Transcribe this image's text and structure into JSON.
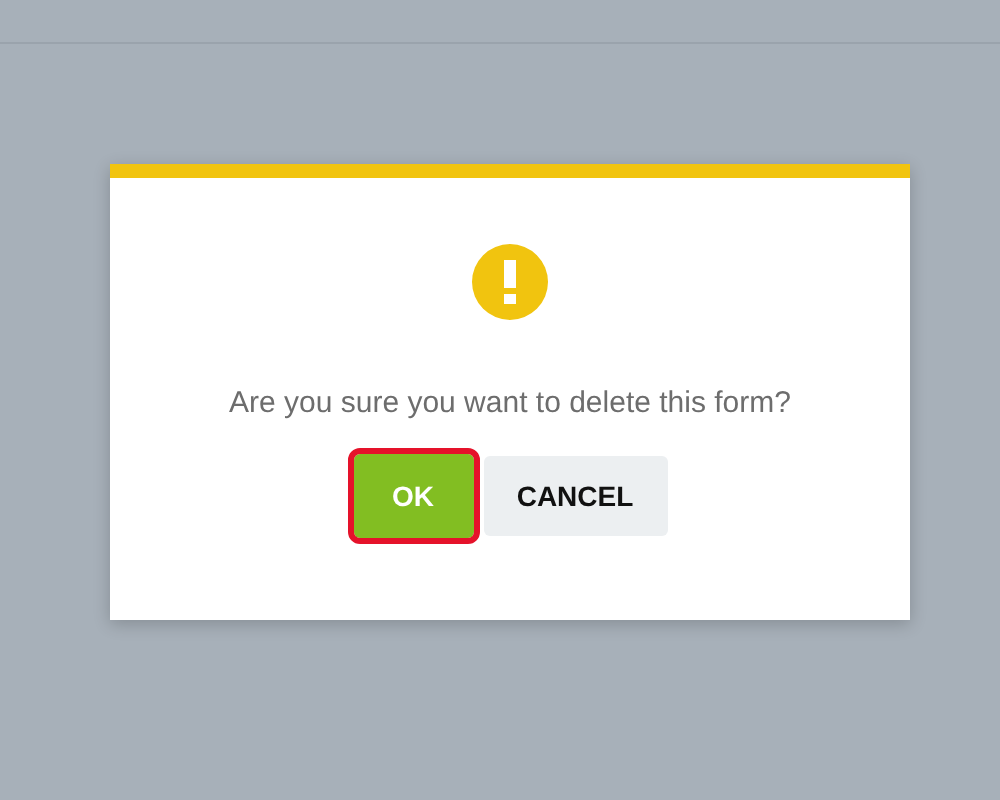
{
  "dialog": {
    "message": "Are you sure you want to delete this form?",
    "buttons": [
      {
        "label": "OK",
        "kind": "primary",
        "focused": true
      },
      {
        "label": "CANCEL",
        "kind": "secondary",
        "focused": false
      }
    ]
  }
}
